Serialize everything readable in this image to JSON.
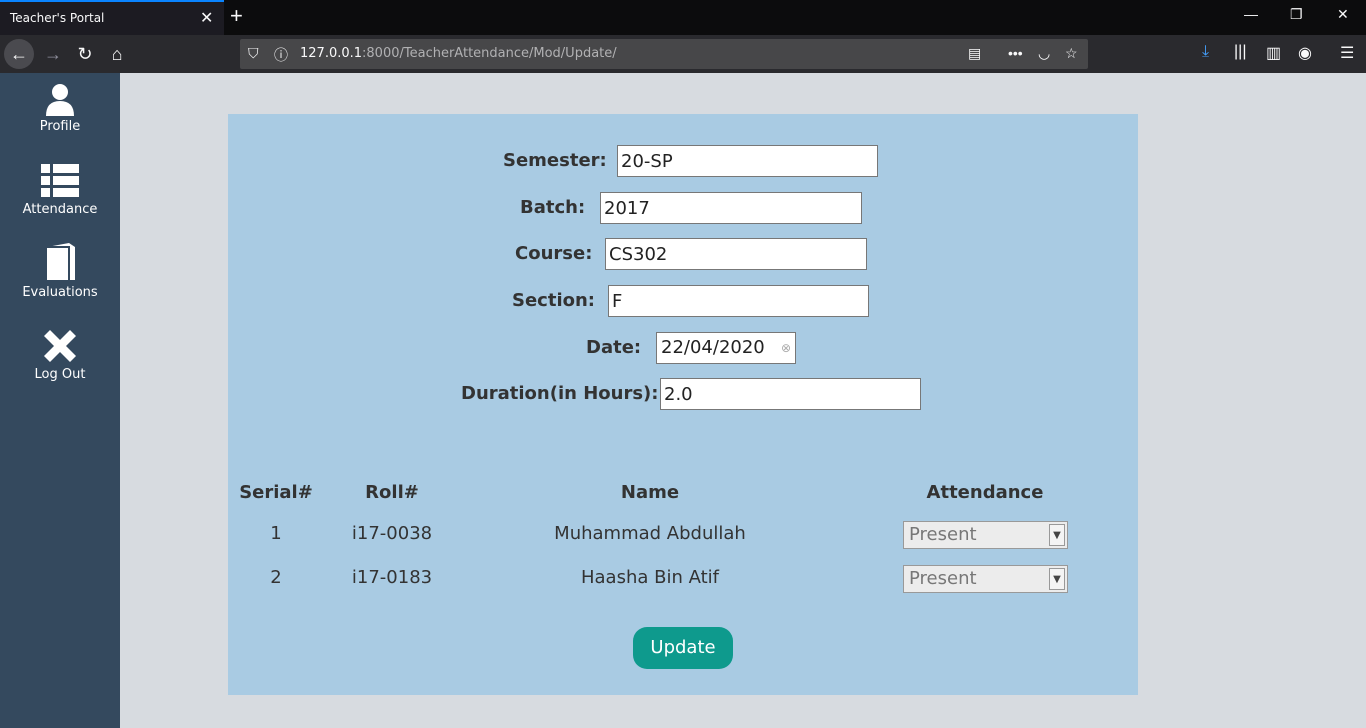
{
  "browser": {
    "tab_title": "Teacher's Portal",
    "url_host": "127.0.0.1",
    "url_path": ":8000/TeacherAttendance/Mod/Update/"
  },
  "sidebar": {
    "items": [
      {
        "label": "Profile",
        "icon": "user-icon"
      },
      {
        "label": "Attendance",
        "icon": "list-icon"
      },
      {
        "label": "Evaluations",
        "icon": "book-icon"
      },
      {
        "label": "Log Out",
        "icon": "close-icon"
      }
    ]
  },
  "form": {
    "semester_label": "Semester:",
    "semester_value": "20-SP",
    "batch_label": "Batch:",
    "batch_value": "2017",
    "course_label": "Course:",
    "course_value": "CS302",
    "section_label": "Section:",
    "section_value": "F",
    "date_label": "Date:",
    "date_value": "22/04/2020",
    "duration_label": "Duration(in Hours):",
    "duration_value": "2.0"
  },
  "table": {
    "headers": [
      "Serial#",
      "Roll#",
      "Name",
      "Attendance"
    ],
    "rows": [
      {
        "serial": "1",
        "roll": "i17-0038",
        "name": "Muhammad Abdullah",
        "attendance": "Present"
      },
      {
        "serial": "2",
        "roll": "i17-0183",
        "name": "Haasha Bin Atif",
        "attendance": "Present"
      }
    ]
  },
  "update_label": "Update",
  "colors": {
    "sidebar": "#34495e",
    "card": "#a9cbe3",
    "button": "#0e9a8d"
  }
}
